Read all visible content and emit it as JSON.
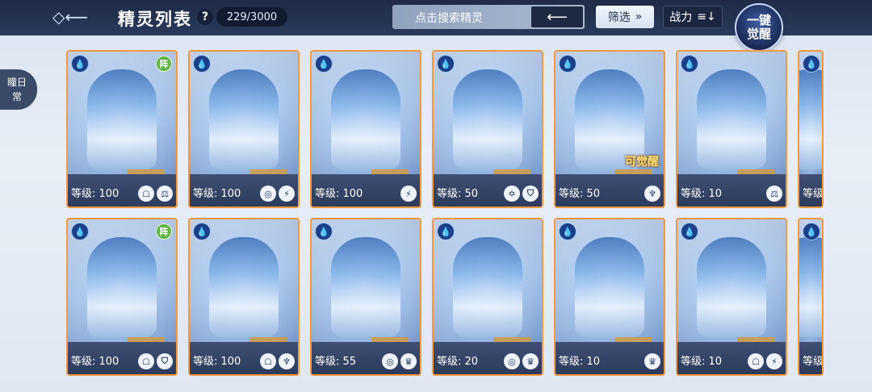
{
  "header": {
    "back_icon": "diamond-arrow-back-icon",
    "title": "精灵列表",
    "help_label": "?",
    "count": "229/3000",
    "search_placeholder": "点击搜索精灵",
    "search_button_label": "⟵",
    "filter_label": "筛选",
    "filter_icon": "double-chevron-down-icon",
    "sort_label": "战力",
    "sort_icon": "sort-desc-icon",
    "awaken_all_label_line1": "一键",
    "awaken_all_label_line2": "觉醒"
  },
  "side_tab": {
    "line1": "瞳日",
    "line2": "常"
  },
  "team_badge_label": "阵",
  "awaken_badge_label": "可觉醒",
  "cards": [
    {
      "level_text": "等级: 100",
      "team": true,
      "awaken": false,
      "skills": [
        "☖",
        "⚖"
      ]
    },
    {
      "level_text": "等级: 100",
      "team": false,
      "awaken": false,
      "skills": [
        "◎",
        "⚡"
      ]
    },
    {
      "level_text": "等级: 100",
      "team": false,
      "awaken": false,
      "skills": [
        "⚡"
      ]
    },
    {
      "level_text": "等级: 50",
      "team": false,
      "awaken": false,
      "skills": [
        "✡",
        "⛉"
      ]
    },
    {
      "level_text": "等级: 50",
      "team": false,
      "awaken": true,
      "skills": [
        "♆"
      ]
    },
    {
      "level_text": "等级: 10",
      "team": false,
      "awaken": false,
      "skills": [
        "⚖"
      ]
    },
    {
      "level_text": "等级",
      "team": false,
      "awaken": false,
      "skills": []
    },
    {
      "level_text": "等级: 100",
      "team": true,
      "awaken": false,
      "skills": [
        "☖",
        "⛉"
      ]
    },
    {
      "level_text": "等级: 100",
      "team": false,
      "awaken": false,
      "skills": [
        "☖",
        "♆"
      ]
    },
    {
      "level_text": "等级: 55",
      "team": false,
      "awaken": false,
      "skills": [
        "◎",
        "♛"
      ]
    },
    {
      "level_text": "等级: 20",
      "team": false,
      "awaken": false,
      "skills": [
        "◎",
        "♛"
      ]
    },
    {
      "level_text": "等级: 10",
      "team": false,
      "awaken": false,
      "skills": [
        "♛"
      ]
    },
    {
      "level_text": "等级: 10",
      "team": false,
      "awaken": false,
      "skills": [
        "☖",
        "⚡"
      ]
    },
    {
      "level_text": "等级",
      "team": false,
      "awaken": false,
      "skills": []
    }
  ],
  "colors": {
    "card_border": "#f39a3f",
    "topbar_bg": "#1f2b46",
    "team_badge": "#62b24a"
  }
}
